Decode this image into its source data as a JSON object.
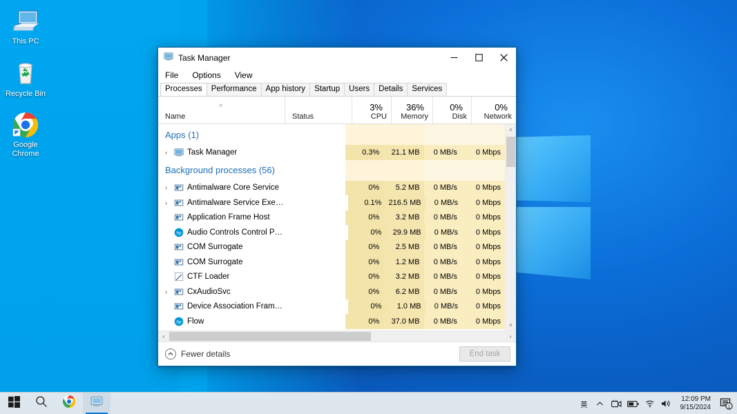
{
  "desktop": {
    "icons": [
      {
        "name": "This PC",
        "icon": "computer-icon"
      },
      {
        "name": "Recycle Bin",
        "icon": "recycle-bin-icon"
      },
      {
        "name": "Google Chrome",
        "icon": "chrome-icon"
      }
    ]
  },
  "window": {
    "title": "Task Manager",
    "icon": "task-manager-icon",
    "minimize": "─",
    "maximize": "☐",
    "close": "✕",
    "menu": [
      "File",
      "Options",
      "View"
    ],
    "tabs": [
      {
        "label": "Processes",
        "active": true
      },
      {
        "label": "Performance",
        "active": false
      },
      {
        "label": "App history",
        "active": false
      },
      {
        "label": "Startup",
        "active": false
      },
      {
        "label": "Users",
        "active": false
      },
      {
        "label": "Details",
        "active": false
      },
      {
        "label": "Services",
        "active": false
      }
    ],
    "columns": {
      "name": {
        "label": "Name",
        "sort_caret": "˄"
      },
      "status": {
        "label": "Status"
      },
      "cpu": {
        "label": "CPU",
        "pct": "3%"
      },
      "memory": {
        "label": "Memory",
        "pct": "36%"
      },
      "disk": {
        "label": "Disk",
        "pct": "0%"
      },
      "network": {
        "label": "Network",
        "pct": "0%"
      }
    },
    "groups": [
      {
        "title": "Apps (1)"
      },
      {
        "title": "Background processes (56)"
      }
    ],
    "rows": [
      {
        "kind": "group",
        "title": "Apps (1)"
      },
      {
        "kind": "proc",
        "expander": true,
        "icon": "task-manager-icon",
        "name": "Task Manager",
        "status": "",
        "cpu": "0.3%",
        "memory": "21.1 MB",
        "disk": "0 MB/s",
        "network": "0 Mbps",
        "shade": "a"
      },
      {
        "kind": "group",
        "title": "Background processes (56)"
      },
      {
        "kind": "proc",
        "expander": true,
        "icon": "generic-process-icon",
        "name": "Antimalware Core Service",
        "status": "",
        "cpu": "0%",
        "memory": "5.2 MB",
        "disk": "0 MB/s",
        "network": "0 Mbps",
        "shade": "a"
      },
      {
        "kind": "proc",
        "expander": true,
        "icon": "generic-process-icon",
        "name": "Antimalware Service Executable",
        "status": "",
        "cpu": "0.1%",
        "memory": "216.5 MB",
        "disk": "0 MB/s",
        "network": "0 Mbps",
        "shade": "a"
      },
      {
        "kind": "proc",
        "expander": false,
        "icon": "generic-process-icon",
        "name": "Application Frame Host",
        "status": "",
        "cpu": "0%",
        "memory": "3.2 MB",
        "disk": "0 MB/s",
        "network": "0 Mbps",
        "shade": "a"
      },
      {
        "kind": "proc",
        "expander": false,
        "icon": "hp-icon",
        "name": "Audio Controls Control Panel",
        "status": "",
        "cpu": "0%",
        "memory": "29.9 MB",
        "disk": "0 MB/s",
        "network": "0 Mbps",
        "shade": "a"
      },
      {
        "kind": "proc",
        "expander": false,
        "icon": "generic-process-icon",
        "name": "COM Surrogate",
        "status": "",
        "cpu": "0%",
        "memory": "2.5 MB",
        "disk": "0 MB/s",
        "network": "0 Mbps",
        "shade": "a"
      },
      {
        "kind": "proc",
        "expander": false,
        "icon": "generic-process-icon",
        "name": "COM Surrogate",
        "status": "",
        "cpu": "0%",
        "memory": "1.2 MB",
        "disk": "0 MB/s",
        "network": "0 Mbps",
        "shade": "a"
      },
      {
        "kind": "proc",
        "expander": false,
        "icon": "ctf-loader-icon",
        "name": "CTF Loader",
        "status": "",
        "cpu": "0%",
        "memory": "3.2 MB",
        "disk": "0 MB/s",
        "network": "0 Mbps",
        "shade": "a"
      },
      {
        "kind": "proc",
        "expander": true,
        "icon": "generic-process-icon",
        "name": "CxAudioSvc",
        "status": "",
        "cpu": "0%",
        "memory": "6.2 MB",
        "disk": "0 MB/s",
        "network": "0 Mbps",
        "shade": "a"
      },
      {
        "kind": "proc",
        "expander": false,
        "icon": "generic-process-icon",
        "name": "Device Association Framework ...",
        "status": "",
        "cpu": "0%",
        "memory": "1.0 MB",
        "disk": "0 MB/s",
        "network": "0 Mbps",
        "shade": "a"
      },
      {
        "kind": "proc",
        "expander": false,
        "icon": "hp-icon",
        "name": "Flow",
        "status": "",
        "cpu": "0%",
        "memory": "37.0 MB",
        "disk": "0 MB/s",
        "network": "0 Mbps",
        "shade": "a"
      }
    ],
    "statusbar": {
      "fewer_details": "Fewer details",
      "fewer_details_icon": "chevron-up-circle-icon",
      "end_task": "End task"
    },
    "scroll": {
      "v_up": "˄",
      "v_down": "˅",
      "h_left": "‹",
      "h_right": "›"
    }
  },
  "taskbar": {
    "start": "start-icon",
    "search": "search-icon",
    "chrome": "chrome-icon",
    "taskmanager": "task-manager-icon",
    "ime": "英",
    "tray": [
      {
        "icon": "chevron-up-icon"
      },
      {
        "icon": "meet-now-icon"
      },
      {
        "icon": "battery-icon"
      },
      {
        "icon": "wifi-icon"
      },
      {
        "icon": "volume-icon"
      }
    ],
    "clock": {
      "time": "12:09 PM",
      "date": "9/15/2024"
    },
    "notifications": {
      "icon": "notification-center-icon",
      "count": "1"
    }
  },
  "colors": {
    "accent": "#0078d7",
    "desktop_blue": "#00a6ef",
    "group_header": "#1f6fbb",
    "heat_cell": "#f3e4ab"
  }
}
